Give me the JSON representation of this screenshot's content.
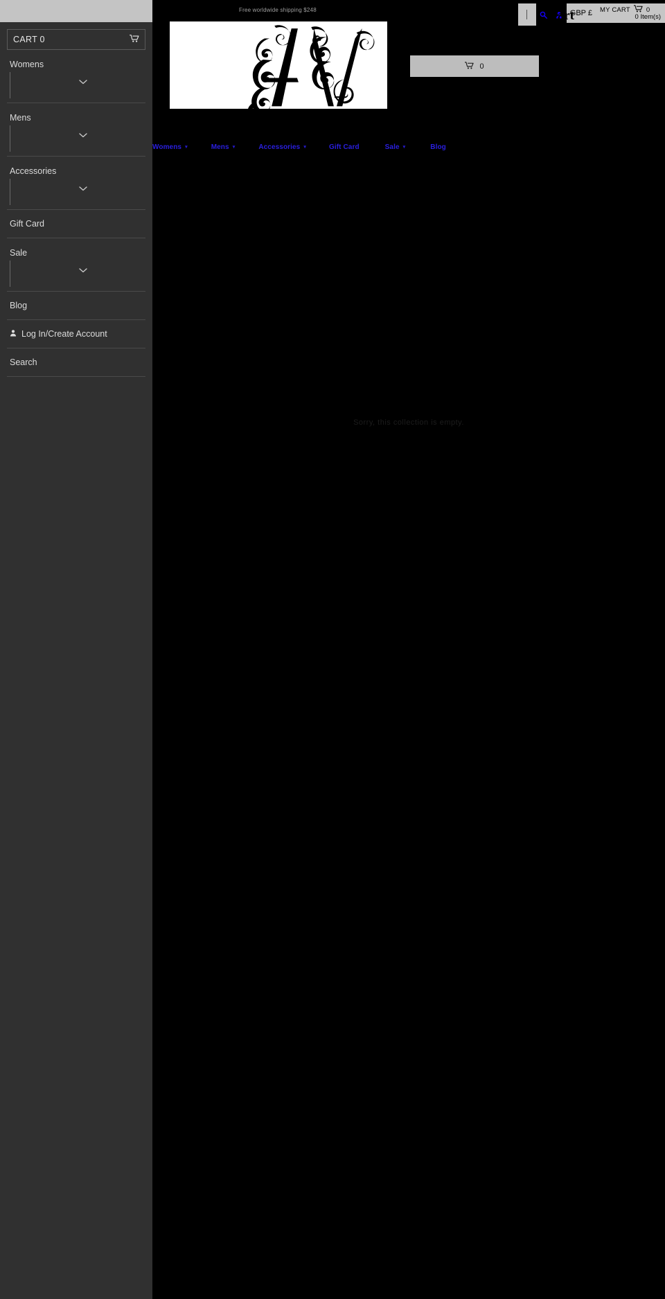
{
  "announcement": {
    "message": "Free worldwide shipping $248"
  },
  "header": {
    "search_placeholder": "",
    "search_value": "",
    "search_icon": "search-icon",
    "account_icon": "user-icon",
    "currency_label": "GBP £",
    "cart_label": "MY CART",
    "cart_icon": "shopping-cart-icon",
    "cart_count": "0",
    "cart_items_text": "0 Item(s)",
    "cart_overlay_text": "Cart"
  },
  "logo": {
    "alt": "AV",
    "letters": "AV"
  },
  "mini_cart": {
    "icon": "shopping-cart-icon",
    "count": "0"
  },
  "mainnav": {
    "items": [
      {
        "label": "Womens",
        "has_dropdown": true,
        "chevron": "chevron-down-icon"
      },
      {
        "label": "Mens",
        "has_dropdown": true,
        "chevron": "chevron-down-icon"
      },
      {
        "label": "Accessories",
        "has_dropdown": true,
        "chevron": "chevron-down-icon"
      },
      {
        "label": "Gift Card",
        "has_dropdown": false,
        "chevron": ""
      },
      {
        "label": "Sale",
        "has_dropdown": true,
        "chevron": "chevron-down-icon"
      },
      {
        "label": "Blog",
        "has_dropdown": false,
        "chevron": ""
      }
    ]
  },
  "sidebar": {
    "search_value": "",
    "search_placeholder": "",
    "cart": {
      "label": "CART 0",
      "icon": "shopping-cart-icon"
    },
    "items": [
      {
        "label": "Womens",
        "type": "expandable",
        "chevron": "chevron-down-icon"
      },
      {
        "label": "Mens",
        "type": "expandable",
        "chevron": "chevron-down-icon"
      },
      {
        "label": "Accessories",
        "type": "expandable",
        "chevron": "chevron-down-icon"
      },
      {
        "label": "Gift Card",
        "type": "link",
        "chevron": ""
      },
      {
        "label": "Sale",
        "type": "expandable",
        "chevron": "chevron-down-icon"
      },
      {
        "label": "Blog",
        "type": "link",
        "chevron": ""
      }
    ],
    "account": {
      "label": "Log In/Create Account",
      "icon": "user-icon"
    },
    "search_link": {
      "label": "Search"
    }
  },
  "center_note": {
    "text": "Sorry, this collection is empty."
  },
  "colors": {
    "page_background": "#000000",
    "sidebar_background": "#303030",
    "sidebar_text": "#dcdcdc",
    "control_gray": "#c6c6c6",
    "nav_link": "#2a1fe0",
    "icon_blue": "#1500ff"
  }
}
